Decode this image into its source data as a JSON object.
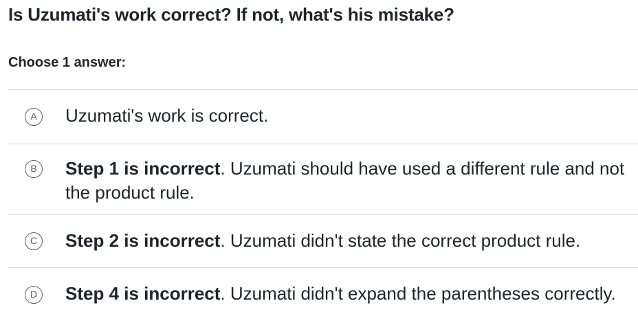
{
  "question": {
    "text": "Is Uzumati's work correct? If not, what's his mistake?"
  },
  "instructions": "Choose 1 answer:",
  "choices": [
    {
      "letter": "A",
      "bold": "",
      "text": "Uzumati's work is correct."
    },
    {
      "letter": "B",
      "bold": "Step 1 is incorrect",
      "text": ". Uzumati should have used a different rule and not the product rule."
    },
    {
      "letter": "C",
      "bold": "Step 2 is incorrect",
      "text": ". Uzumati didn't state the correct product rule."
    },
    {
      "letter": "D",
      "bold": "Step 4 is incorrect",
      "text": ". Uzumati didn't expand the parentheses correctly."
    }
  ]
}
